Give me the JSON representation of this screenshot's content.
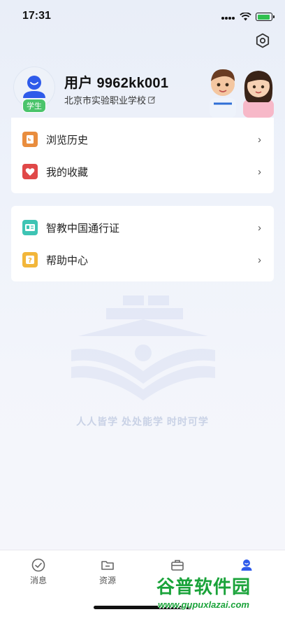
{
  "status_bar": {
    "time": "17:31"
  },
  "profile": {
    "name": "用户 9962kk001",
    "school": "北京市实验职业学校",
    "role_badge": "学生"
  },
  "menu_card_1": [
    {
      "label": "浏览历史",
      "icon": "history-icon",
      "color": "#e98d3e"
    },
    {
      "label": "我的收藏",
      "icon": "heart-icon",
      "color": "#e04848"
    }
  ],
  "menu_card_2": [
    {
      "label": "智教中国通行证",
      "icon": "id-card-icon",
      "color": "#3ec4b4"
    },
    {
      "label": "帮助中心",
      "icon": "help-icon",
      "color": "#f2b63a"
    }
  ],
  "watermark": {
    "slogan": "人人皆学 处处能学  时时可学"
  },
  "tabbar": {
    "tabs": [
      {
        "label": "消息",
        "icon": "check-circle-icon"
      },
      {
        "label": "资源",
        "icon": "folder-icon"
      },
      {
        "label": "",
        "icon": "briefcase-icon"
      },
      {
        "label": "",
        "icon": "user-icon",
        "active": true
      }
    ]
  },
  "site_watermark": {
    "brand": "谷普软件园",
    "url": "www.gupuxlazai.com"
  },
  "colors": {
    "accent": "#2f5bea",
    "badge": "#4bc46b",
    "watermark_green": "#1aa33a"
  }
}
